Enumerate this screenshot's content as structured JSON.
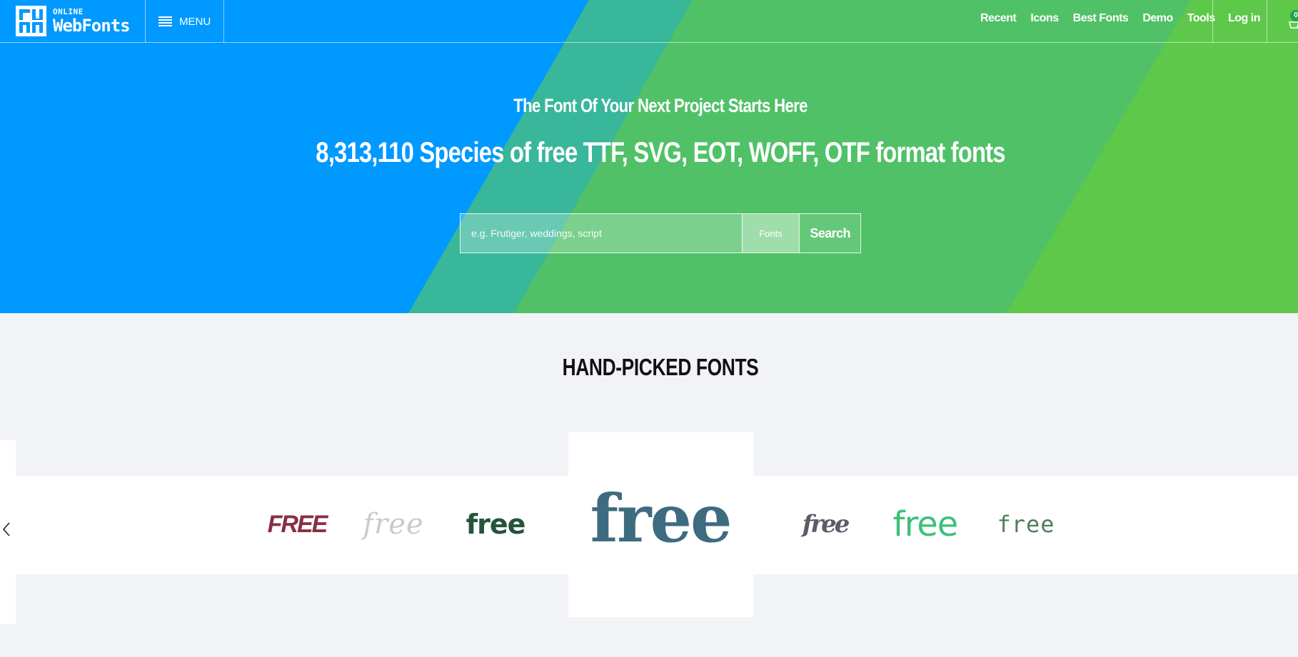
{
  "brand": {
    "logo_small": "ONLINE",
    "logo_big": "WebFonts"
  },
  "header": {
    "menu_label": "MENU",
    "nav": [
      "Recent",
      "Icons",
      "Best Fonts",
      "Demo",
      "Tools"
    ],
    "login_label": "Log in",
    "cart_count": "0"
  },
  "hero": {
    "subtitle": "The Font Of Your Next Project Starts Here",
    "title": "8,313,110 Species of free TTF, SVG, EOT, WOFF, OTF format fonts",
    "search_placeholder": "e.g. Frutiger, weddings, script",
    "search_type": "Fonts",
    "search_button": "Search",
    "colors": {
      "blue": "#0099ff",
      "teal": "#33b89a",
      "green": "#52c266",
      "lime": "#5fc84a"
    }
  },
  "handpicked": {
    "title": "HAND-PICKED FONTS",
    "samples": [
      "FREE",
      "free",
      "free",
      "free",
      "free",
      "free",
      "free"
    ],
    "prev_icon": "chevron-left-icon"
  }
}
